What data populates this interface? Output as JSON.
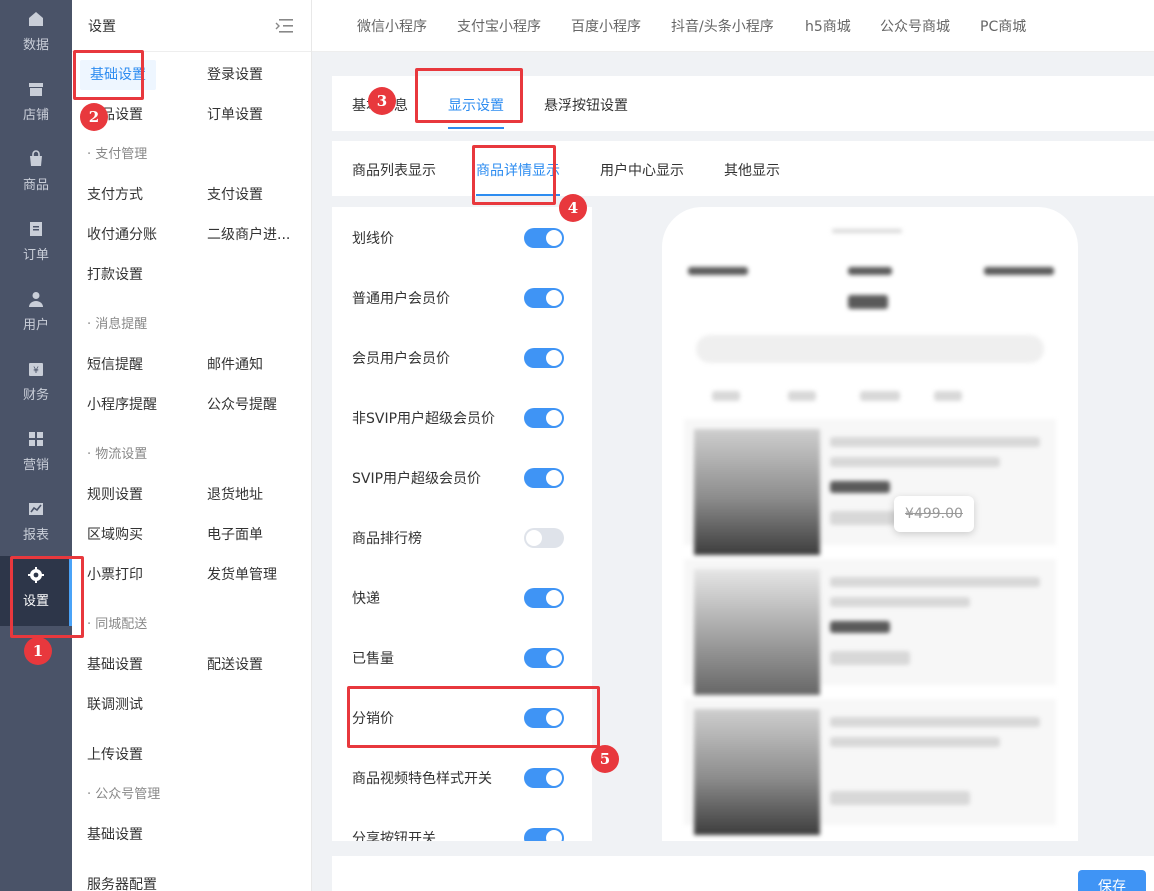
{
  "rail": [
    {
      "label": "数据",
      "icon": "home-icon"
    },
    {
      "label": "店铺",
      "icon": "store-icon"
    },
    {
      "label": "商品",
      "icon": "bag-icon"
    },
    {
      "label": "订单",
      "icon": "document-icon"
    },
    {
      "label": "用户",
      "icon": "user-icon"
    },
    {
      "label": "财务",
      "icon": "yen-icon"
    },
    {
      "label": "营销",
      "icon": "grid-icon"
    },
    {
      "label": "报表",
      "icon": "chart-icon"
    },
    {
      "label": "设置",
      "icon": "gear-icon"
    }
  ],
  "subnav": {
    "title": "设置",
    "items": {
      "basic": "基础设置",
      "login": "登录设置",
      "product": "商品设置",
      "order": "订单设置",
      "g_pay": "· 支付管理",
      "paymethod": "支付方式",
      "paysetting": "支付设置",
      "split": "收付通分账",
      "merchant": "二级商户进...",
      "payout": "打款设置",
      "g_msg": "· 消息提醒",
      "sms": "短信提醒",
      "mail": "邮件通知",
      "mini": "小程序提醒",
      "mp": "公众号提醒",
      "g_logistics": "· 物流设置",
      "rule": "规则设置",
      "return": "退货地址",
      "region": "区域购买",
      "esheet": "电子面单",
      "ticket": "小票打印",
      "ship": "发货单管理",
      "g_city": "· 同城配送",
      "city_basic": "基础设置",
      "delivery": "配送设置",
      "debug": "联调测试",
      "upload": "上传设置",
      "g_mp": "· 公众号管理",
      "mp_basic": "基础设置",
      "server": "服务器配置"
    }
  },
  "toptabs": [
    "微信小程序",
    "支付宝小程序",
    "百度小程序",
    "抖音/头条小程序",
    "h5商城",
    "公众号商城",
    "PC商城"
  ],
  "panel1_tabs": [
    "基本信息",
    "显示设置",
    "悬浮按钮设置"
  ],
  "panel2_tabs": [
    "商品列表显示",
    "商品详情显示",
    "用户中心显示",
    "其他显示"
  ],
  "settings": [
    {
      "label": "划线价",
      "on": true
    },
    {
      "label": "普通用户会员价",
      "on": true
    },
    {
      "label": "会员用户会员价",
      "on": true
    },
    {
      "label": "非SVIP用户超级会员价",
      "on": true
    },
    {
      "label": "SVIP用户超级会员价",
      "on": true
    },
    {
      "label": "商品排行榜",
      "on": false
    },
    {
      "label": "快递",
      "on": true
    },
    {
      "label": "已售量",
      "on": true
    },
    {
      "label": "分销价",
      "on": true
    },
    {
      "label": "商品视频特色样式开关",
      "on": true
    },
    {
      "label": "分享按钮开关",
      "on": true
    }
  ],
  "preview": {
    "price_tip": "¥499.00"
  },
  "save_label": "保存",
  "badges": [
    "1",
    "2",
    "3",
    "4",
    "5"
  ],
  "colors": {
    "accent": "#2d8cf0",
    "annotation": "#e8383d",
    "rail": "#4a5368"
  }
}
